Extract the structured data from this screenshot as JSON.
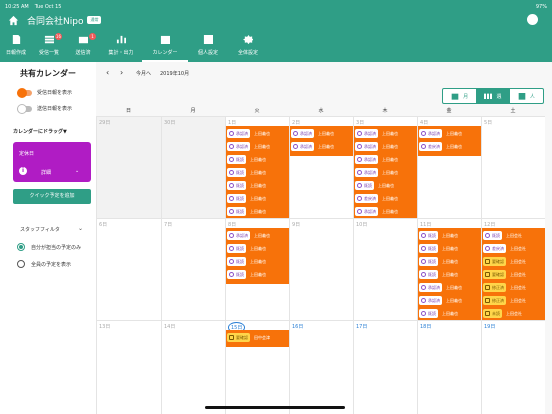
{
  "status_bar": {
    "time": "10:25 AM",
    "date": "Tue Oct 15",
    "battery": "97%"
  },
  "app": {
    "title": "合同会社Nipo",
    "badge": "通常"
  },
  "tabs": [
    {
      "name": "tab-nippo",
      "label": "日報作成",
      "icon": "document-icon",
      "badge": ""
    },
    {
      "name": "tab-inbox",
      "label": "受信一覧",
      "icon": "list-icon",
      "badge": "16"
    },
    {
      "name": "tab-sent",
      "label": "送信済",
      "icon": "send-icon",
      "badge": "1"
    },
    {
      "name": "tab-stats",
      "label": "集計・出力",
      "icon": "chart-icon",
      "badge": ""
    },
    {
      "name": "tab-calendar",
      "label": "カレンダー",
      "icon": "calendar-icon",
      "badge": ""
    },
    {
      "name": "tab-personal",
      "label": "個人設定",
      "icon": "person-card-icon",
      "badge": ""
    },
    {
      "name": "tab-global",
      "label": "全体設定",
      "icon": "gear-icon",
      "badge": ""
    }
  ],
  "sidebar": {
    "title": "共有カレンダー",
    "toggle_recv": "受信日報を表示",
    "toggle_sent": "送信日報を表示",
    "drag_label": "カレンダーにドラッグ▼",
    "card_title": "定休日",
    "card_detail": "詳細",
    "card_chevron": "⌄",
    "quick_add": "クイック予定を追加",
    "filter_label": "スタッフフィルタ",
    "filter_chevron": "⌄",
    "radio_mine": "自分が担当の予定のみ",
    "radio_all": "全員の予定を表示"
  },
  "nav": {
    "prev": "‹",
    "next": "›",
    "today": "今月へ",
    "current": "2019年10月"
  },
  "view_toggle": [
    {
      "label": "月",
      "icon": "calendar-icon"
    },
    {
      "label": "週",
      "icon": "week-icon"
    },
    {
      "label": "人",
      "icon": "person-card-icon"
    }
  ],
  "weekdays": [
    "日",
    "月",
    "火",
    "水",
    "木",
    "金",
    "土"
  ],
  "weeks": [
    {
      "days": [
        {
          "num": "29日",
          "other": true,
          "events": []
        },
        {
          "num": "30日",
          "other": true,
          "events": []
        },
        {
          "num": "1日",
          "events": [
            {
              "b": "承認済",
              "n": "上田義也"
            },
            {
              "b": "承認済",
              "n": "上田義也"
            },
            {
              "b": "既読",
              "n": "上田義也"
            },
            {
              "b": "既読",
              "n": "上田義也"
            },
            {
              "b": "既読",
              "n": "上田義也"
            },
            {
              "b": "既読",
              "n": "上田義也"
            },
            {
              "b": "既読",
              "n": "上田義也"
            }
          ]
        },
        {
          "num": "2日",
          "events": [
            {
              "b": "承認済",
              "n": "上田義也"
            },
            {
              "b": "承認済",
              "n": "上田義也"
            }
          ]
        },
        {
          "num": "3日",
          "events": [
            {
              "b": "承認済",
              "n": "上田義也"
            },
            {
              "b": "承認済",
              "n": "上田義也"
            },
            {
              "b": "承認済",
              "n": "上田義也"
            },
            {
              "b": "承認済",
              "n": "上田義也"
            },
            {
              "b": "既読",
              "n": "上田義也"
            },
            {
              "b": "差戻済",
              "n": "上田義也"
            },
            {
              "b": "承認済",
              "n": "上田義也"
            }
          ]
        },
        {
          "num": "4日",
          "events": [
            {
              "b": "承認済",
              "n": "上田義也"
            },
            {
              "b": "差戻済",
              "n": "上田義也"
            }
          ]
        },
        {
          "num": "5日",
          "events": []
        }
      ]
    },
    {
      "days": [
        {
          "num": "6日",
          "events": []
        },
        {
          "num": "7日",
          "events": []
        },
        {
          "num": "8日",
          "events": [
            {
              "b": "承認済",
              "n": "上田義也"
            },
            {
              "b": "既読",
              "n": "上田義也"
            },
            {
              "b": "既読",
              "n": "上田義也"
            },
            {
              "b": "既読",
              "n": "上田義也"
            }
          ]
        },
        {
          "num": "9日",
          "events": []
        },
        {
          "num": "10日",
          "events": []
        },
        {
          "num": "11日",
          "events": [
            {
              "b": "既読",
              "n": "上田義也"
            },
            {
              "b": "既読",
              "n": "上田義也"
            },
            {
              "b": "既読",
              "n": "上田義也"
            },
            {
              "b": "既読",
              "n": "上田義也"
            },
            {
              "b": "承認済",
              "n": "上田義也"
            },
            {
              "b": "承認済",
              "n": "上田義也"
            },
            {
              "b": "既読",
              "n": "上田義也"
            }
          ]
        },
        {
          "num": "12日",
          "events": [
            {
              "b": "既読",
              "n": "上田会社"
            },
            {
              "b": "差戻済",
              "n": "上田会社"
            },
            {
              "b": "要確認",
              "n": "上田会社",
              "y": true
            },
            {
              "b": "要確認",
              "n": "上田会社",
              "y": true
            },
            {
              "b": "修正済",
              "n": "上田会社",
              "y": true
            },
            {
              "b": "修正済",
              "n": "上田会社",
              "y": true
            },
            {
              "b": "未読",
              "n": "上田会社",
              "y": true
            }
          ]
        }
      ]
    },
    {
      "days": [
        {
          "num": "13日",
          "events": []
        },
        {
          "num": "14日",
          "events": []
        },
        {
          "num": "15日",
          "today": true,
          "events": [
            {
              "b": "要確認",
              "n": "田中会津",
              "y": true
            }
          ]
        },
        {
          "num": "16日",
          "blue": true,
          "events": []
        },
        {
          "num": "17日",
          "blue": true,
          "events": []
        },
        {
          "num": "18日",
          "blue": true,
          "events": []
        },
        {
          "num": "19日",
          "blue": true,
          "events": []
        }
      ]
    }
  ]
}
